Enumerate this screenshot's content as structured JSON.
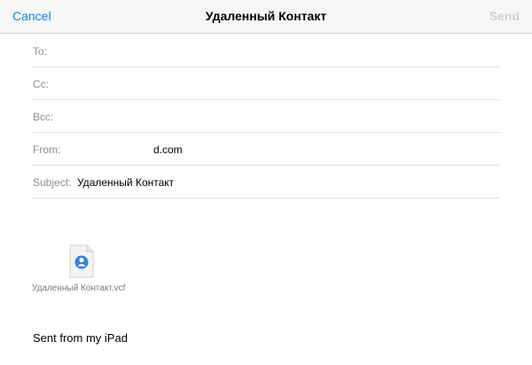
{
  "navbar": {
    "cancel_label": "Cancel",
    "title": "Удаленный Контакт",
    "send_label": "Send",
    "accent_color": "#1a7cf2"
  },
  "fields": {
    "to_label": "To:",
    "cc_label": "Cc:",
    "bcc_label": "Bcc:",
    "from_label": "From:",
    "from_value": "d.com",
    "subject_label": "Subject:",
    "subject_value": "Удаленный Контакт"
  },
  "attachment": {
    "icon": "contact-card-icon",
    "file_name": "Удаленный Контакт.vcf"
  },
  "body": {
    "signature": "Sent from my iPad"
  }
}
